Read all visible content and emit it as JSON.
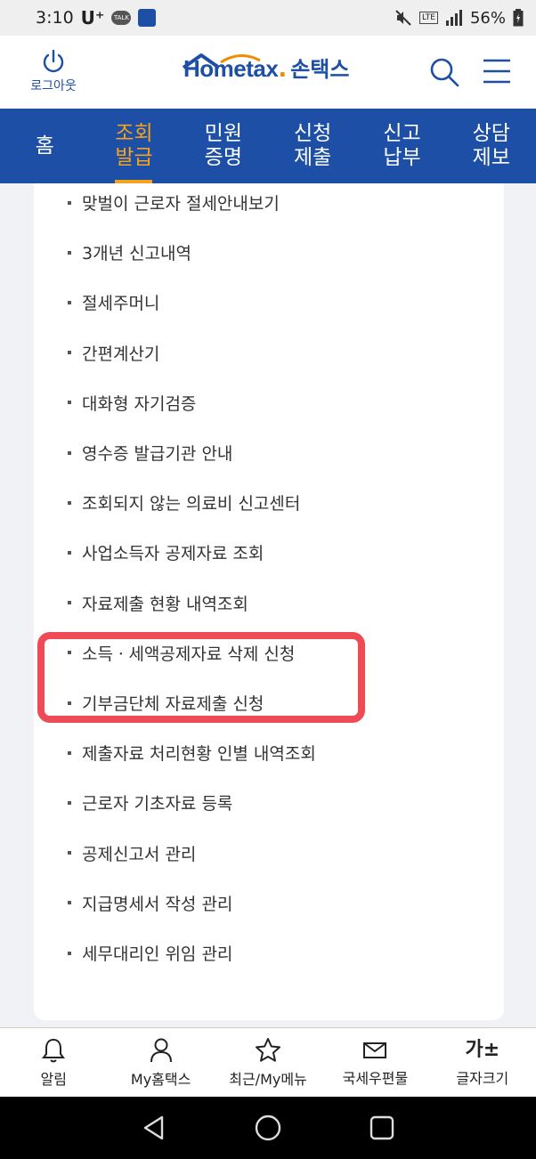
{
  "status_bar": {
    "time": "3:10",
    "carrier": "U⁺",
    "talk_badge": "TALK",
    "network": "LTE",
    "battery": "56%",
    "icons": [
      "kakaotalk-icon",
      "hometax-app-icon",
      "mute-icon",
      "lte-icon",
      "signal-icon",
      "battery-icon"
    ]
  },
  "header": {
    "logout_label": "로그아웃",
    "logo_en": "Hometax",
    "logo_kr": "손택스",
    "brand_color": "#1d4fa6",
    "accent_color": "#f08c00"
  },
  "nav": {
    "items": [
      {
        "label": "홈",
        "active": false
      },
      {
        "label": "조회\n발급",
        "active": true
      },
      {
        "label": "민원\n증명",
        "active": false
      },
      {
        "label": "신청\n제출",
        "active": false
      },
      {
        "label": "신고\n납부",
        "active": false
      },
      {
        "label": "상담\n제보",
        "active": false
      }
    ],
    "active_color": "#f5a21c"
  },
  "menu": {
    "items": [
      "맞벌이 근로자 절세안내보기",
      "3개년 신고내역",
      "절세주머니",
      "간편계산기",
      "대화형 자기검증",
      "영수증 발급기관 안내",
      "조회되지 않는 의료비 신고센터",
      "사업소득자 공제자료 조회",
      "자료제출 현황 내역조회",
      "소득ㆍ세액공제자료 삭제 신청",
      "기부금단체 자료제출 신청",
      "제출자료 처리현황 인별 내역조회",
      "근로자 기초자료 등록",
      "공제신고서 관리",
      "지급명세서 작성 관리",
      "세무대리인 위임 관리"
    ],
    "highlighted_index": 9,
    "highlight_color": "#ee4b57"
  },
  "bottom_bar": {
    "items": [
      {
        "label": "알림",
        "icon": "bell-icon"
      },
      {
        "label": "My홈택스",
        "icon": "person-icon"
      },
      {
        "label": "최근/My메뉴",
        "icon": "star-icon"
      },
      {
        "label": "국세우편물",
        "icon": "mail-icon"
      },
      {
        "label": "글자크기",
        "icon": "font-size-icon",
        "glyph": "가±"
      }
    ]
  }
}
